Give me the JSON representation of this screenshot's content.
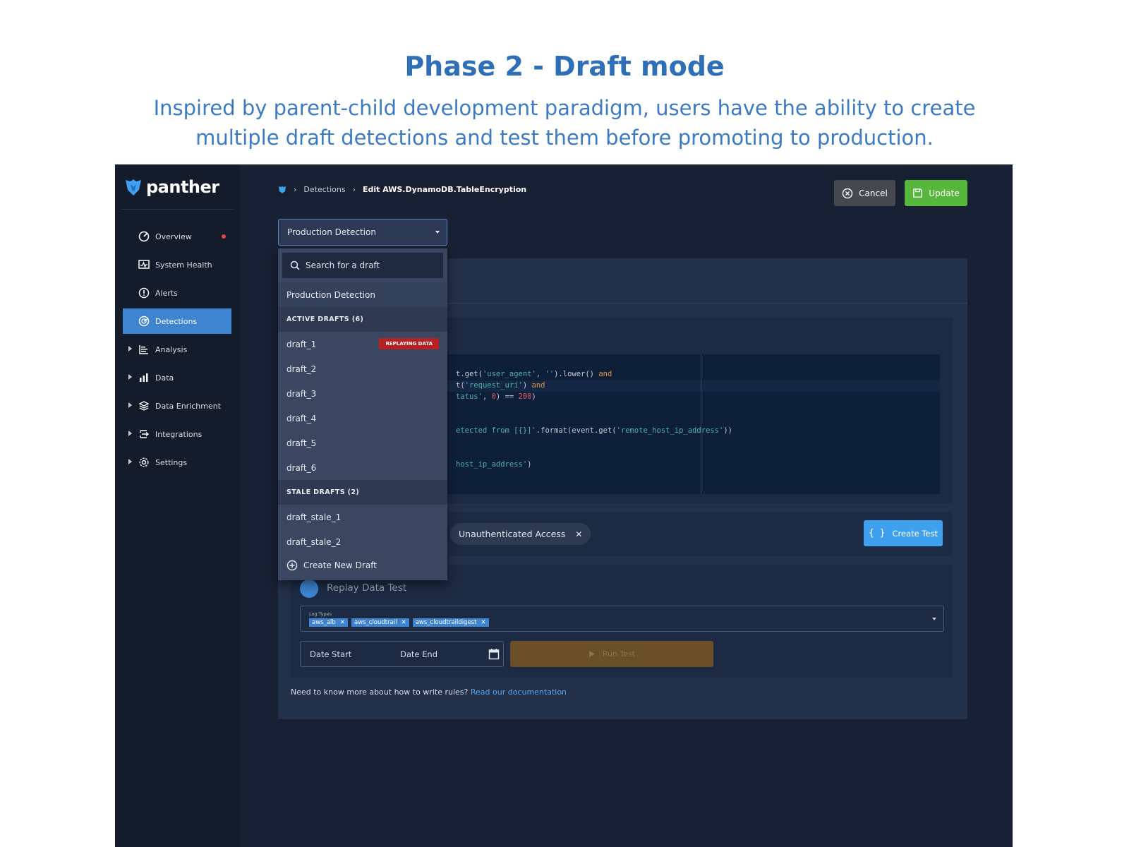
{
  "slide": {
    "title": "Phase 2 - Draft mode",
    "subtitle": "Inspired by parent-child development paradigm, users have the ability to create multiple draft detections and test them before promoting to production."
  },
  "app": {
    "brand": "panther",
    "sidebar": {
      "items": [
        {
          "label": "Overview",
          "icon": "gauge-icon",
          "has_caret": false,
          "active": false,
          "notification_dot": true
        },
        {
          "label": "System Health",
          "icon": "heartbeat-monitor-icon",
          "has_caret": false,
          "active": false
        },
        {
          "label": "Alerts",
          "icon": "alert-circle-icon",
          "has_caret": false,
          "active": false
        },
        {
          "label": "Detections",
          "icon": "radar-icon",
          "has_caret": false,
          "active": true
        },
        {
          "label": "Analysis",
          "icon": "bar-list-icon",
          "has_caret": true,
          "active": false
        },
        {
          "label": "Data",
          "icon": "bar-chart-icon",
          "has_caret": true,
          "active": false
        },
        {
          "label": "Data Enrichment",
          "icon": "layers-icon",
          "has_caret": true,
          "active": false
        },
        {
          "label": "Integrations",
          "icon": "integrations-icon",
          "has_caret": true,
          "active": false
        },
        {
          "label": "Settings",
          "icon": "gear-icon",
          "has_caret": true,
          "active": false
        }
      ]
    },
    "breadcrumb": {
      "items": [
        "Detections",
        "Edit AWS.DynamoDB.TableEncryption"
      ]
    },
    "actions": {
      "cancel": "Cancel",
      "update": "Update"
    },
    "colors": {
      "accent": "#3f84d1",
      "update": "#57b63c",
      "badge": "#b72121",
      "run_disabled": "#6a4f28"
    },
    "detection_select": {
      "value": "Production Detection",
      "search_placeholder": "Search for a draft",
      "production_option": "Production Detection",
      "active_header": "ACTIVE DRAFTS (6)",
      "active_drafts": [
        "draft_1",
        "draft_2",
        "draft_3",
        "draft_4",
        "draft_5",
        "draft_6"
      ],
      "replay_badge": "REPLAYING DATA",
      "stale_header": "STALE DRAFTS (2)",
      "stale_drafts": [
        "draft_stale_1",
        "draft_stale_2"
      ],
      "create_label": "Create New Draft"
    },
    "code_lines": [
      [
        "t.get(",
        "'user_agent'",
        ", ",
        "''",
        ").lower() ",
        "and"
      ],
      [
        "t(",
        "'request_uri'",
        ") ",
        "and"
      ],
      [
        "tatus'",
        ", ",
        "0",
        ") == ",
        "200",
        ")"
      ],
      [
        "etected from [{}]'",
        ".format(event.get(",
        "'remote_host_ip_address'",
        "))"
      ],
      [
        "host_ip_address'",
        ")"
      ]
    ],
    "tests": {
      "tag": "Unauthenticated Access",
      "create_test": "Create Test",
      "replay_title": "Replay Data Test",
      "log_types_label": "Log Types",
      "log_types": [
        "aws_alb",
        "aws_cloudtrail",
        "aws_cloudtraildigest"
      ],
      "date_start": "Date Start",
      "date_end": "Date End",
      "run_test": "Run Test"
    },
    "help": {
      "text": "Need to know more about how to write rules?",
      "link": "Read our documentation"
    }
  }
}
